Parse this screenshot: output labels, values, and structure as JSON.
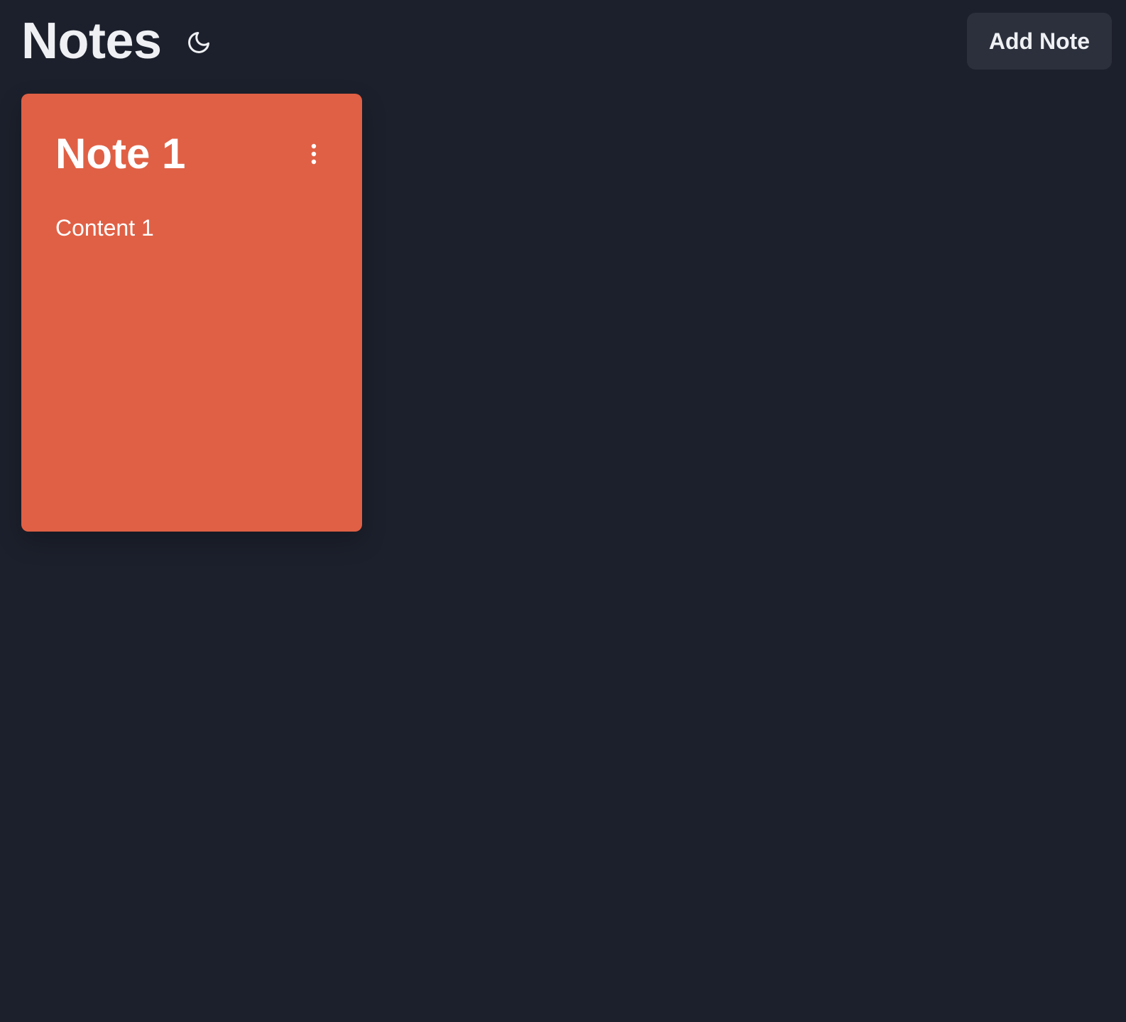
{
  "header": {
    "title": "Notes",
    "theme_icon": "moon-icon",
    "add_button_label": "Add Note"
  },
  "notes": [
    {
      "title": "Note 1",
      "content": "Content 1",
      "color": "#e06045",
      "menu_icon": "more-vertical-icon"
    }
  ],
  "colors": {
    "background": "#1c202c",
    "button_background": "#2b303c",
    "text_primary": "#eef0f3",
    "note_accent": "#e06045"
  }
}
